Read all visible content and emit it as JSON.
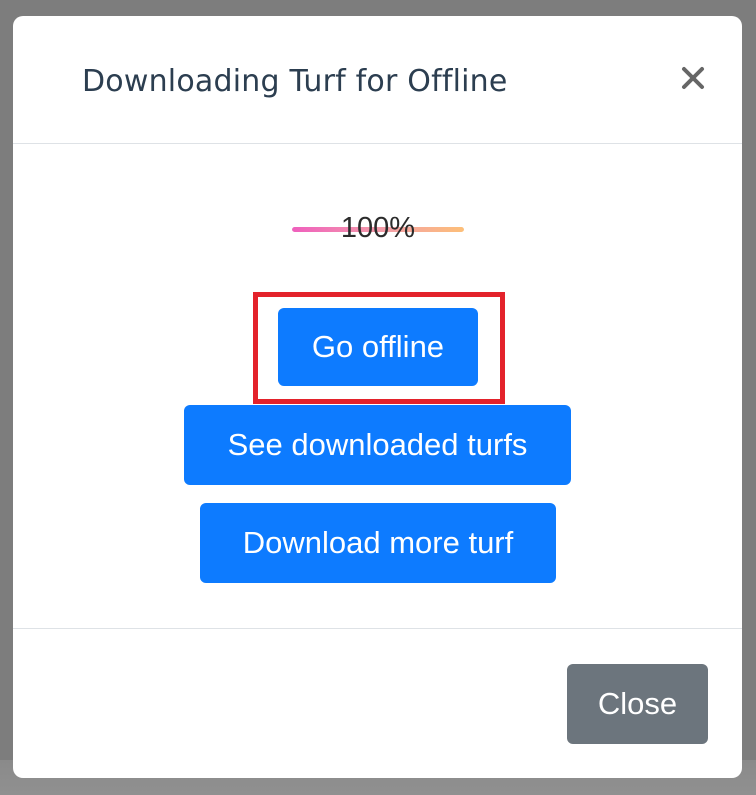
{
  "modal": {
    "title": "Downloading Turf for Offline",
    "close_icon": "close-icon"
  },
  "progress": {
    "value": 100,
    "label": "100%",
    "gradient_colors": [
      "#ef5fbd",
      "#f4a0a8",
      "#fdbf78"
    ]
  },
  "actions": {
    "go_offline_label": "Go offline",
    "see_downloaded_label": "See downloaded turfs",
    "download_more_label": "Download more turf"
  },
  "footer": {
    "close_label": "Close"
  },
  "colors": {
    "primary": "#0d7bff",
    "secondary": "#6c757d",
    "highlight": "#e3222b",
    "title": "#2c3e50"
  }
}
